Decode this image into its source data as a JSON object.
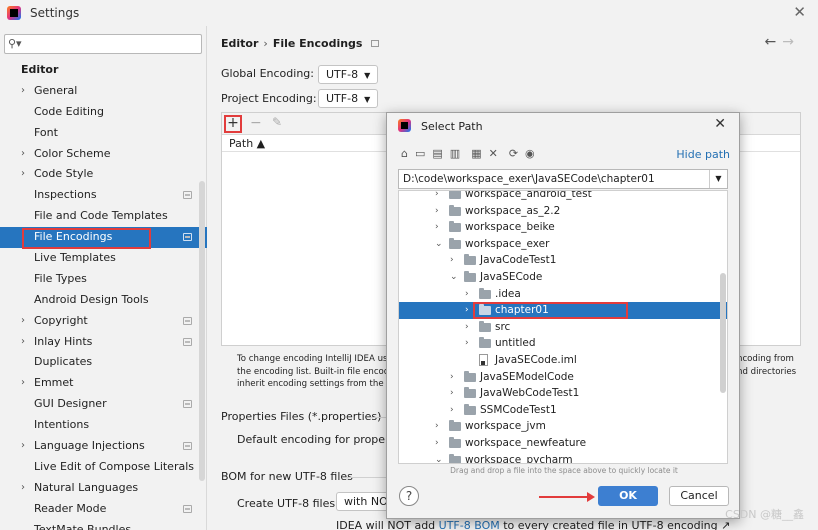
{
  "window": {
    "title": "Settings",
    "close": "✕"
  },
  "search": {
    "placeholder": "",
    "icon": "search-icon"
  },
  "sidebar": {
    "items": [
      {
        "label": "Editor",
        "kind": "head"
      },
      {
        "label": "General",
        "kind": "expand"
      },
      {
        "label": "Code Editing",
        "kind": "leaf"
      },
      {
        "label": "Font",
        "kind": "leaf"
      },
      {
        "label": "Color Scheme",
        "kind": "expand"
      },
      {
        "label": "Code Style",
        "kind": "expand"
      },
      {
        "label": "Inspections",
        "kind": "leaf",
        "settings": true
      },
      {
        "label": "File and Code Templates",
        "kind": "leaf"
      },
      {
        "label": "File Encodings",
        "kind": "leaf",
        "settings": true,
        "selected": true
      },
      {
        "label": "Live Templates",
        "kind": "leaf"
      },
      {
        "label": "File Types",
        "kind": "leaf"
      },
      {
        "label": "Android Design Tools",
        "kind": "leaf"
      },
      {
        "label": "Copyright",
        "kind": "expand",
        "settings": true
      },
      {
        "label": "Inlay Hints",
        "kind": "expand",
        "settings": true
      },
      {
        "label": "Duplicates",
        "kind": "leaf"
      },
      {
        "label": "Emmet",
        "kind": "expand"
      },
      {
        "label": "GUI Designer",
        "kind": "leaf",
        "settings": true
      },
      {
        "label": "Intentions",
        "kind": "leaf"
      },
      {
        "label": "Language Injections",
        "kind": "expand",
        "settings": true
      },
      {
        "label": "Live Edit of Compose Literals",
        "kind": "leaf"
      },
      {
        "label": "Natural Languages",
        "kind": "expand"
      },
      {
        "label": "Reader Mode",
        "kind": "leaf",
        "settings": true
      },
      {
        "label": "TextMate Bundles",
        "kind": "leaf"
      }
    ]
  },
  "content": {
    "breadcrumb": {
      "root": "Editor",
      "sep": "›",
      "page": "File Encodings"
    },
    "nav": {
      "back": "←",
      "forward": "→"
    },
    "global_label": "Global Encoding:",
    "global_value": "UTF-8",
    "project_label": "Project Encoding:",
    "project_value": "UTF-8",
    "table": {
      "add": "+",
      "remove": "−",
      "edit": "✎",
      "column": "Path ▲"
    },
    "note_left": "To change encoding IntelliJ IDEA use",
    "note_left2": "the encoding list. Built-in file encodin",
    "note_left3": "inherit encoding settings from the pa",
    "note_right": "ncoding from",
    "note_right2": "nd directories",
    "properties_header": "Properties Files (*.properties)",
    "properties_default": "Default encoding for propertie",
    "bom_header": "BOM for new UTF-8 files",
    "bom_label": "Create UTF-8 files:",
    "bom_value": "with NO B",
    "bom_note_prefix": "IDEA will NOT add",
    "bom_note_link": "UTF-8 BOM",
    "bom_note_suffix": "to every created file in UTF-8 encoding ↗"
  },
  "dialog": {
    "title": "Select Path",
    "close": "✕",
    "hide_path": "Hide path",
    "path": "D:\\code\\workspace_exer\\JavaSECode\\chapter01",
    "drag_hint": "Drag and drop a file into the space above to quickly locate it",
    "ok": "OK",
    "cancel": "Cancel",
    "help": "?",
    "tree": [
      {
        "label": "workspace_android_test",
        "indent": 0,
        "chev": "›",
        "type": "folder"
      },
      {
        "label": "workspace_as_2.2",
        "indent": 0,
        "chev": "›",
        "type": "folder"
      },
      {
        "label": "workspace_beike",
        "indent": 0,
        "chev": "›",
        "type": "folder"
      },
      {
        "label": "workspace_exer",
        "indent": 0,
        "chev": "⌄",
        "type": "folder"
      },
      {
        "label": "JavaCodeTest1",
        "indent": 1,
        "chev": "›",
        "type": "folder"
      },
      {
        "label": "JavaSECode",
        "indent": 1,
        "chev": "⌄",
        "type": "folder"
      },
      {
        "label": ".idea",
        "indent": 2,
        "chev": "›",
        "type": "folder"
      },
      {
        "label": "chapter01",
        "indent": 2,
        "chev": "›",
        "type": "folder",
        "selected": true
      },
      {
        "label": "src",
        "indent": 2,
        "chev": "›",
        "type": "folder"
      },
      {
        "label": "untitled",
        "indent": 2,
        "chev": "›",
        "type": "folder"
      },
      {
        "label": "JavaSECode.iml",
        "indent": 2,
        "chev": "",
        "type": "file"
      },
      {
        "label": "JavaSEModelCode",
        "indent": 1,
        "chev": "›",
        "type": "folder"
      },
      {
        "label": "JavaWebCodeTest1",
        "indent": 1,
        "chev": "›",
        "type": "folder"
      },
      {
        "label": "SSMCodeTest1",
        "indent": 1,
        "chev": "›",
        "type": "folder"
      },
      {
        "label": "workspace_jvm",
        "indent": 0,
        "chev": "›",
        "type": "folder"
      },
      {
        "label": "workspace_newfeature",
        "indent": 0,
        "chev": "›",
        "type": "folder"
      },
      {
        "label": "workspace_pycharm",
        "indent": 0,
        "chev": "⌄",
        "type": "folder"
      }
    ]
  },
  "watermark": "CSDN @糖__鑫"
}
